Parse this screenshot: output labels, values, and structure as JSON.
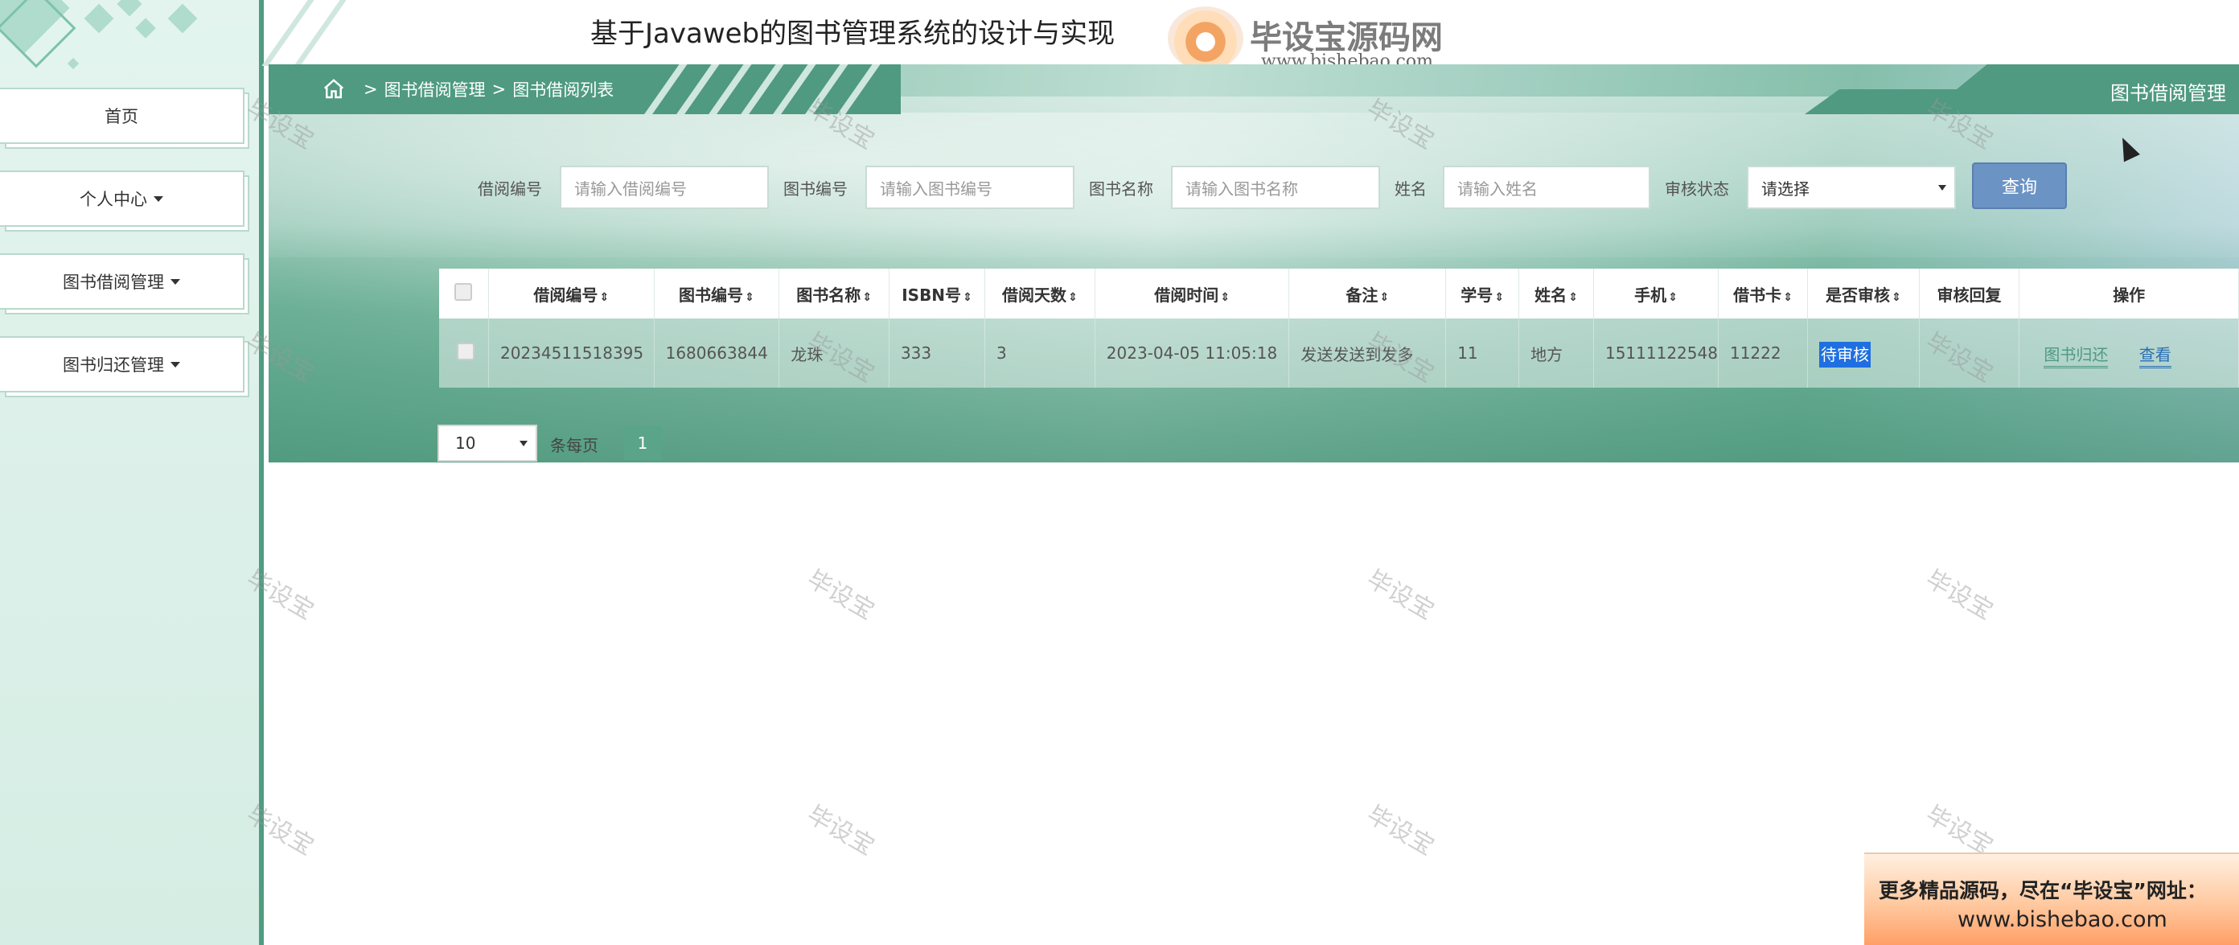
{
  "header": {
    "app_title": "基于Javaweb的图书管理系统的设计与实现",
    "watermark_brand": "毕设宝源码网",
    "watermark_url": "www.bishebao.com",
    "fullscreen_icon": "expand-icon",
    "user_icon": "user-icon"
  },
  "sidebar": {
    "items": [
      {
        "label": "首页",
        "has_dropdown": false
      },
      {
        "label": "个人中心",
        "has_dropdown": true
      },
      {
        "label": "图书借阅管理",
        "has_dropdown": true
      },
      {
        "label": "图书归还管理",
        "has_dropdown": true
      }
    ]
  },
  "breadcrumb": {
    "items": [
      "图书借阅管理",
      "图书借阅列表"
    ],
    "separator": ">"
  },
  "page_tag": "图书借阅管理",
  "search": {
    "fields": [
      {
        "label": "借阅编号",
        "placeholder": "请输入借阅编号"
      },
      {
        "label": "图书编号",
        "placeholder": "请输入图书编号"
      },
      {
        "label": "图书名称",
        "placeholder": "请输入图书名称"
      },
      {
        "label": "姓名",
        "placeholder": "请输入姓名"
      }
    ],
    "status_label": "审核状态",
    "status_value": "请选择",
    "query_button": "查询"
  },
  "table": {
    "columns": [
      "借阅编号",
      "图书编号",
      "图书名称",
      "ISBN号",
      "借阅天数",
      "借阅时间",
      "备注",
      "学号",
      "姓名",
      "手机",
      "借书卡",
      "是否审核",
      "审核回复",
      "操作"
    ],
    "sortable": [
      true,
      true,
      true,
      true,
      true,
      true,
      true,
      true,
      true,
      true,
      true,
      true,
      false,
      false
    ],
    "rows": [
      {
        "borrow_no": "20234511518395",
        "book_no": "1680663844",
        "book_name": "龙珠",
        "isbn": "333",
        "days": "3",
        "borrow_time": "2023-04-05 11:05:18",
        "remark": "发送发送到发多",
        "student_no": "11",
        "name": "地方",
        "phone": "15111122548",
        "card": "11222",
        "audit_status": "待审核",
        "audit_reply": "",
        "actions": [
          "图书归还",
          "查看"
        ]
      }
    ]
  },
  "pagination": {
    "page_size": "10",
    "page_size_label": "条每页",
    "current_page": "1"
  },
  "watermark_text": "毕设宝",
  "promo": {
    "line1": "更多精品源码，尽在“毕设宝”网址：",
    "line2": "www.bishebao.com"
  },
  "colors": {
    "primary_green": "#4f9a81",
    "query_button": "#6b93c4",
    "pending_badge": "#1f6fe0",
    "link_blue": "#2a6fb8"
  }
}
